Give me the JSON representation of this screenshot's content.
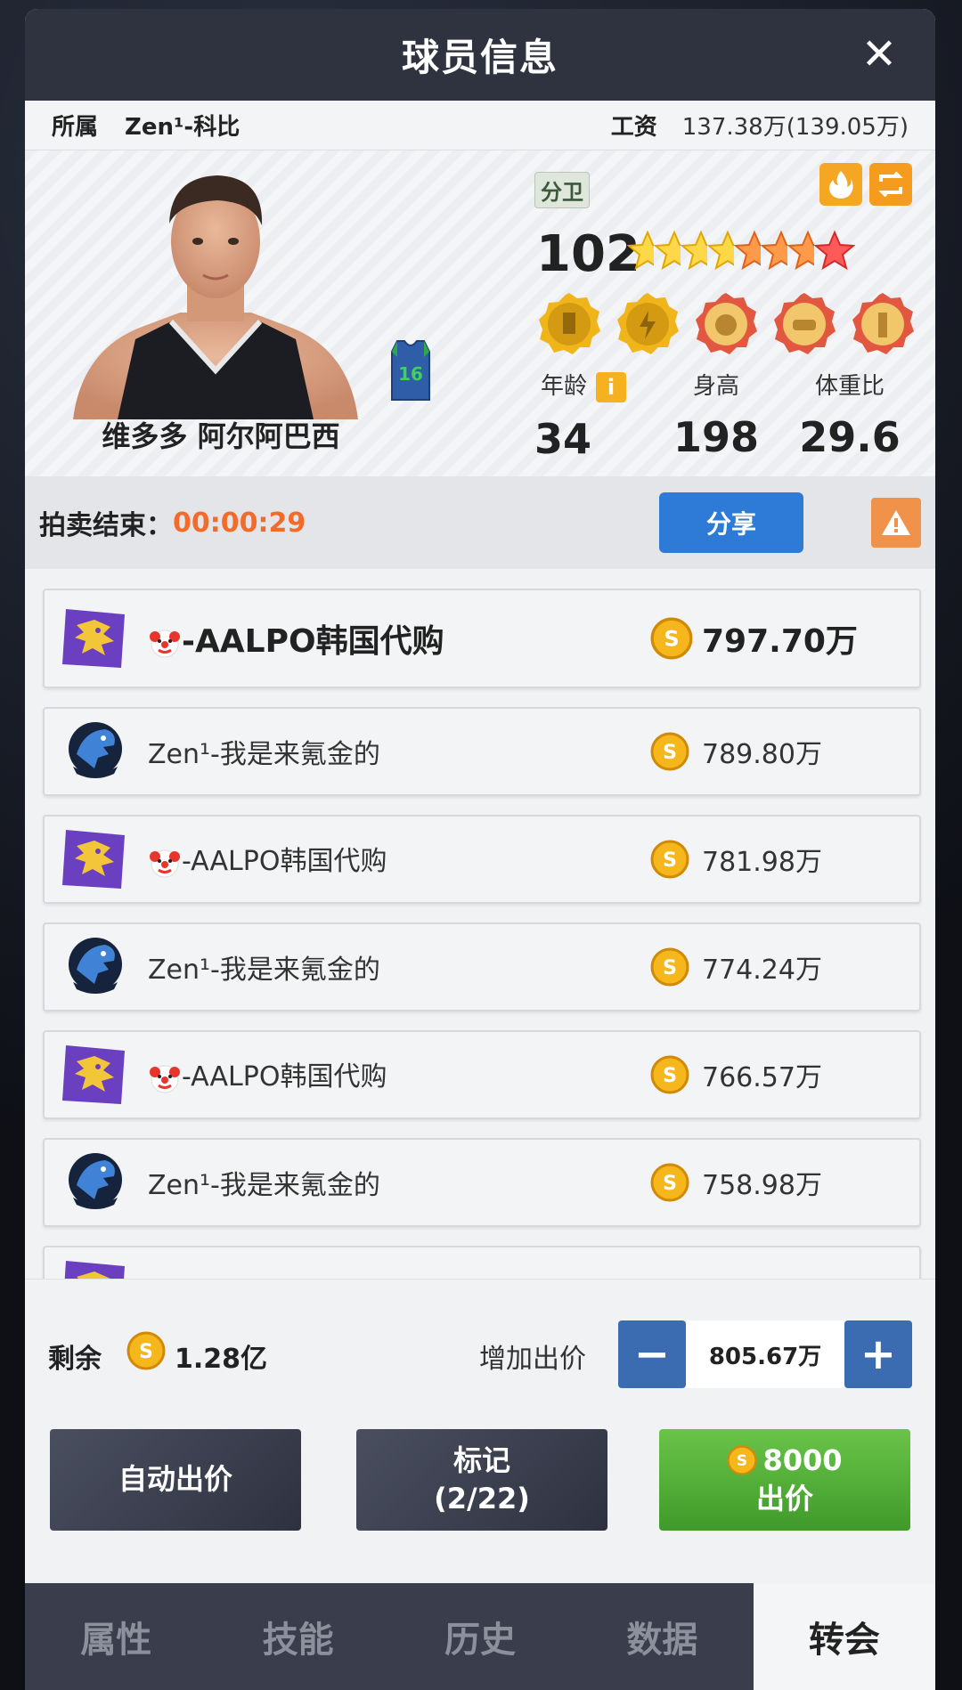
{
  "header": {
    "title": "球员信息",
    "close_icon": "close-icon"
  },
  "info": {
    "team_label": "所属",
    "team_value": "Zen¹-科比",
    "salary_label": "工资",
    "salary_value": "137.38万(139.05万)"
  },
  "player": {
    "name": "维多多 阿尔阿巴西",
    "jersey_number": "16",
    "position": "分卫",
    "rating": "102",
    "stars_total": 8,
    "stars_gold": 4,
    "stars_orange": 3,
    "stars_red": 1,
    "stats": {
      "age_label": "年龄",
      "age_value": "34",
      "height_label": "身高",
      "height_value": "198",
      "weight_label": "体重比",
      "weight_value": "29.6"
    },
    "info_glyph": "i"
  },
  "auction": {
    "label": "拍卖结束：",
    "time": "00:00:29",
    "share_label": "分享"
  },
  "bids": [
    {
      "bidder": "-AALPO韩国代购",
      "clown": true,
      "team": "dragon",
      "amount": "797.70万"
    },
    {
      "bidder": "Zen¹-我是来氪金的",
      "clown": false,
      "team": "eagle",
      "amount": "789.80万"
    },
    {
      "bidder": "-AALPO韩国代购",
      "clown": true,
      "team": "dragon",
      "amount": "781.98万"
    },
    {
      "bidder": "Zen¹-我是来氪金的",
      "clown": false,
      "team": "eagle",
      "amount": "774.24万"
    },
    {
      "bidder": "-AALPO韩国代购",
      "clown": true,
      "team": "dragon",
      "amount": "766.57万"
    },
    {
      "bidder": "Zen¹-我是来氪金的",
      "clown": false,
      "team": "eagle",
      "amount": "758.98万"
    }
  ],
  "controls": {
    "remain_label": "剩余",
    "remain_value": "1.28亿",
    "raise_label": "增加出价",
    "raise_value": "805.67万",
    "minus": "−",
    "plus": "+"
  },
  "actions": {
    "auto_label": "自动出价",
    "mark_label": "标记",
    "mark_count": "(2/22)",
    "bid_cost": "8000",
    "bid_label": "出价"
  },
  "tabs": [
    "属性",
    "技能",
    "历史",
    "数据",
    "转会"
  ],
  "active_tab": 4,
  "colors": {
    "accent_orange": "#f26b2a",
    "share_blue": "#2d7bd6",
    "bid_green": "#4caf2f"
  }
}
